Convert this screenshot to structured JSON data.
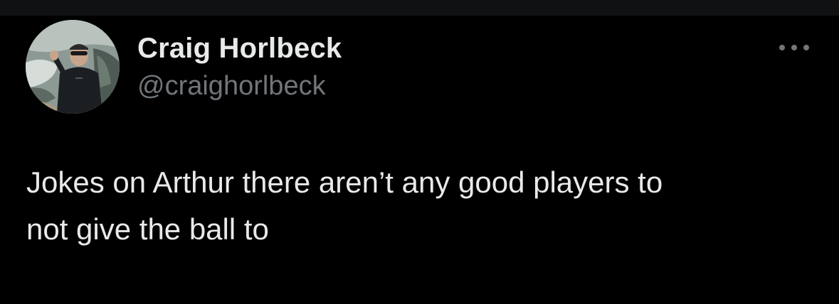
{
  "tweet": {
    "author": {
      "display_name": "Craig Horlbeck",
      "handle": "@craighorlbeck"
    },
    "text": "Jokes on Arthur there aren’t any good players to\nnot give the ball to",
    "more_icon": "more-horizontal-icon"
  },
  "colors": {
    "background": "#000000",
    "primary_text": "#e7e9ea",
    "secondary_text": "#71767b"
  }
}
